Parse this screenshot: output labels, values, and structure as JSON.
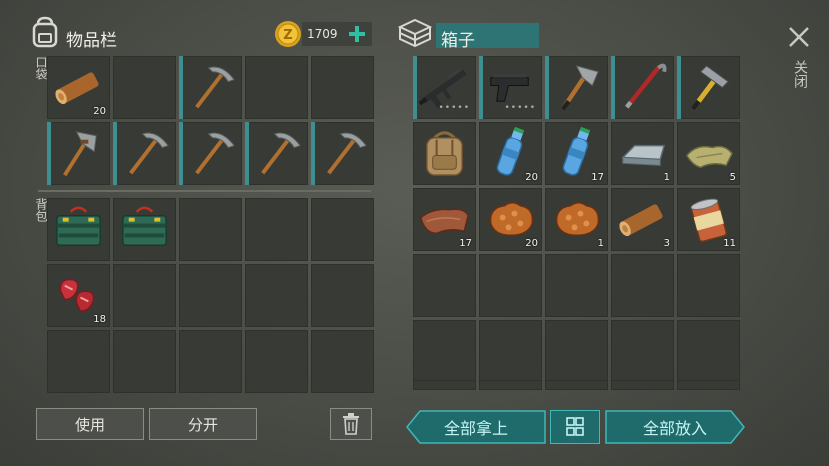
{
  "inventory": {
    "title": "物品栏",
    "coins": "1709",
    "pocket_label": "口袋",
    "backpack_label": "背包",
    "pocket_slots": [
      {
        "icon": "log-icon",
        "count": "20"
      },
      {},
      {
        "icon": "pickaxe-icon"
      },
      {},
      {},
      {
        "icon": "stone-hatchet-icon"
      },
      {
        "icon": "pickaxe-icon"
      },
      {
        "icon": "pickaxe-icon"
      },
      {
        "icon": "pickaxe-icon"
      },
      {
        "icon": "pickaxe-icon"
      }
    ],
    "backpack_slots": [
      {
        "icon": "green-case-icon"
      },
      {
        "icon": "green-case-icon"
      },
      {},
      {},
      {},
      {
        "icon": "raw-meat-icon",
        "count": "18"
      },
      {},
      {},
      {},
      {},
      {},
      {},
      {},
      {},
      {}
    ],
    "use_label": "使用",
    "split_label": "分开"
  },
  "box": {
    "title": "箱子",
    "slots": [
      {
        "icon": "rifle-icon"
      },
      {
        "icon": "pistol-icon"
      },
      {
        "icon": "axe-icon"
      },
      {
        "icon": "crowbar-icon"
      },
      {
        "icon": "hammer-icon"
      },
      {
        "icon": "backpack-icon"
      },
      {
        "icon": "water-bottle-icon",
        "count": "20"
      },
      {
        "icon": "water-bottle-icon",
        "count": "17"
      },
      {
        "icon": "iron-ingot-icon",
        "count": "1"
      },
      {
        "icon": "cloth-icon",
        "count": "5"
      },
      {
        "icon": "leather-icon",
        "count": "17"
      },
      {
        "icon": "mushroom-meat-icon",
        "count": "20"
      },
      {
        "icon": "mushroom-meat-icon",
        "count": "1"
      },
      {
        "icon": "log-icon",
        "count": "3"
      },
      {
        "icon": "canned-food-icon",
        "count": "11"
      },
      {},
      {},
      {},
      {},
      {},
      {},
      {},
      {},
      {},
      {}
    ],
    "take_all_label": "全部拿上",
    "put_all_label": "全部放入"
  },
  "close_label": "关闭"
}
